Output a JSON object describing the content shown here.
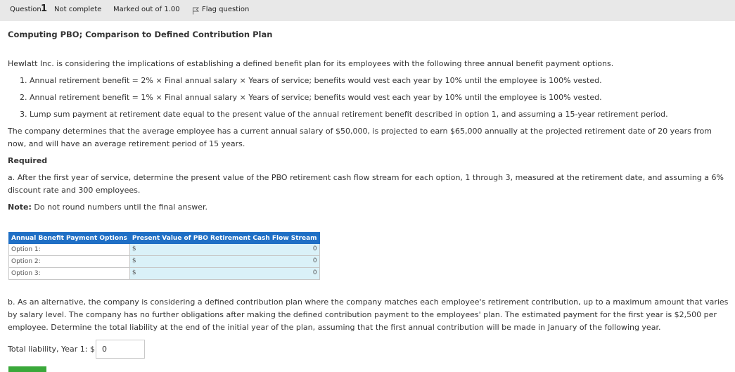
{
  "question_bar": {
    "question_label": "Question",
    "question_number": "1",
    "status": "Not complete",
    "marked": "Marked out of 1.00",
    "flag_label": "Flag question"
  },
  "title": "Computing PBO; Comparison to Defined Contribution Plan",
  "intro": "Hewlatt Inc. is considering the implications of establishing a defined benefit plan for its employees with the following three annual benefit payment options.",
  "options": [
    "1. Annual retirement benefit = 2% × Final annual salary × Years of service; benefits would vest each year by 10% until the employee is 100% vested.",
    "2. Annual retirement benefit = 1% × Final annual salary × Years of service; benefits would vest each year by 10% until the employee is 100% vested.",
    "3. Lump sum payment at retirement date equal to the present value of the annual retirement benefit described in option 1, and assuming a 15-year retirement period."
  ],
  "company_text": "The company determines that the average employee has a current annual salary of $50,000, is projected to earn $65,000 annually at the projected retirement date of 20 years from now, and will have an average retirement period of 15 years.",
  "required_label": "Required",
  "part_a": "a. After the first year of service, determine the present value of the PBO retirement cash flow stream for each option, 1 through 3, measured at the retirement date, and assuming a 6% discount rate and 300 employees.",
  "note_label": "Note:",
  "note_text": "Do not round numbers until the final answer.",
  "table": {
    "headers": [
      "Annual Benefit Payment Options",
      "Present Value of PBO Retirement Cash Flow Stream"
    ],
    "rows": [
      {
        "label": "Option 1:",
        "currency": "$",
        "value": "0"
      },
      {
        "label": "Option 2:",
        "currency": "$",
        "value": "0"
      },
      {
        "label": "Option 3:",
        "currency": "$",
        "value": "0"
      }
    ]
  },
  "part_b": "b. As an alternative, the company is considering a defined contribution plan where the company matches each employee's retirement contribution, up to a maximum amount that varies by salary level. The company has no further obligations after making the defined contribution payment to the employees' plan. The estimated payment for the first year is $2,500 per employee. Determine the total liability at the end of the initial year of the plan, assuming that the first annual contribution will be made in January of the following year.",
  "total_liability": {
    "label": "Total liability, Year 1: $",
    "value": "0"
  },
  "colors": {
    "header_blue": "#1f6fc5",
    "cell_fill": "#daf1f8",
    "bar_gray": "#e8e8e8",
    "button_green": "#3aa83a"
  }
}
